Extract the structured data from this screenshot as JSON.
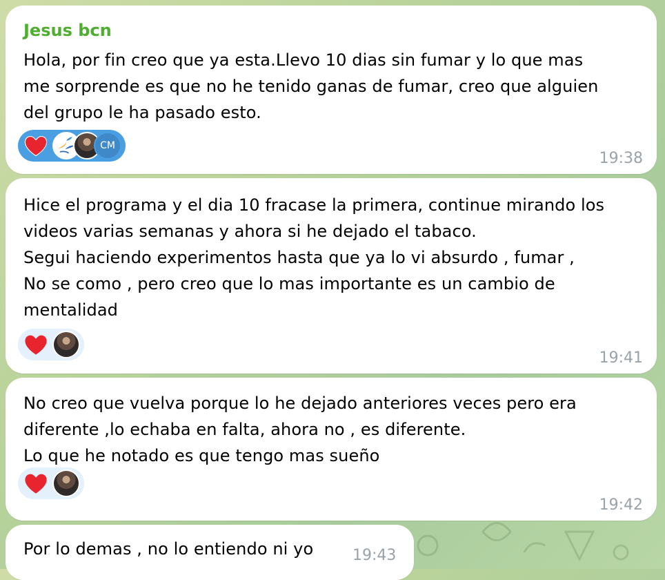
{
  "messages": [
    {
      "sender": "Jesus bcn",
      "text": "Hola, por fin creo que ya esta.Llevo 10 dias sin fumar y lo que mas\nme sorprende es que no he tenido ganas de fumar, creo que alguien\ndel grupo le ha pasado esto.",
      "time": "19:38",
      "reaction_avatar_initials": "CM"
    },
    {
      "text": "Hice el programa y el dia 10 fracase la primera, continue mirando los\nvideos varias semanas y ahora si he dejado el tabaco.\nSegui haciendo experimentos hasta que ya lo vi absurdo , fumar ,\nNo se como , pero creo que lo mas importante es un cambio de\nmentalidad",
      "time": "19:41"
    },
    {
      "text": "No creo que vuelva porque lo he dejado anteriores veces pero era\ndiferente ,lo echaba en falta, ahora no , es diferente.\nLo que he notado es que tengo mas sueño",
      "time": "19:42"
    },
    {
      "text": "Por lo demas , no lo entiendo ni yo",
      "time": "19:43"
    }
  ],
  "colors": {
    "sender": "#4fae2f",
    "bubble": "#ffffff",
    "time": "#9aa3a9",
    "reaction_selected": "#4a9fe3",
    "reaction": "#e4f0fb",
    "heart": "#e8242f"
  },
  "icons": [
    "heart-icon",
    "avatar"
  ]
}
